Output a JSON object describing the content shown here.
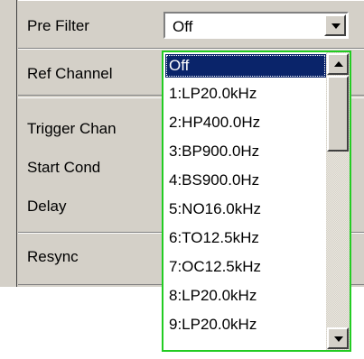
{
  "panel": {
    "rows": [
      {
        "label": "Pre Filter"
      },
      {
        "label": "Ref Channel"
      },
      {
        "label": "Trigger Chan"
      },
      {
        "label": "Start Cond"
      },
      {
        "label": "Delay"
      },
      {
        "label": "Resync"
      }
    ]
  },
  "combo": {
    "value": "Off"
  },
  "dropdown": {
    "options": [
      "Off",
      "1:LP20.0kHz",
      "2:HP400.0Hz",
      "3:BP900.0Hz",
      "4:BS900.0Hz",
      "5:NO16.0kHz",
      "6:TO12.5kHz",
      "7:OC12.5kHz",
      "8:LP20.0kHz",
      "9:LP20.0kHz"
    ],
    "selected_index": 0
  },
  "colors": {
    "selection": "#0a246a",
    "list_border": "#22cc22",
    "panel": "#d4d0c8"
  },
  "icons": {
    "combo_button": "chevron-down-icon",
    "scroll_up": "scroll-up-icon",
    "scroll_down": "scroll-down-icon"
  }
}
